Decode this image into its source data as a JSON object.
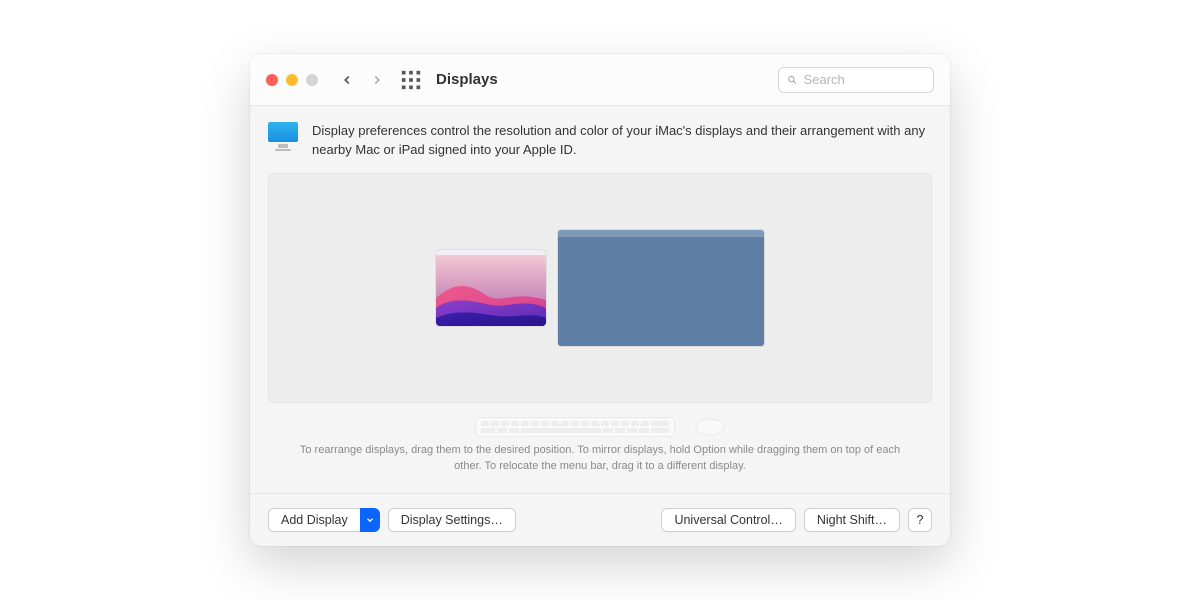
{
  "window": {
    "title": "Displays"
  },
  "search": {
    "placeholder": "Search",
    "value": ""
  },
  "intro": {
    "text": "Display preferences control the resolution and color of your iMac's displays and their arrangement with any nearby Mac or iPad signed into your Apple ID."
  },
  "hint": {
    "text": "To rearrange displays, drag them to the desired position. To mirror displays, hold Option while dragging them on top of each other. To relocate the menu bar, drag it to a different display."
  },
  "buttons": {
    "add_display": "Add Display",
    "display_settings": "Display Settings…",
    "universal_control": "Universal Control…",
    "night_shift": "Night Shift…",
    "help": "?"
  },
  "icons": {
    "back": "chevron-left",
    "forward": "chevron-right",
    "apps": "grid-dots",
    "search": "magnifying-glass",
    "dropdown": "chevron-down",
    "display": "monitor"
  },
  "colors": {
    "accent": "#0a66ff",
    "panel": "#ededed",
    "secondary_display": "#5f7ea5"
  }
}
